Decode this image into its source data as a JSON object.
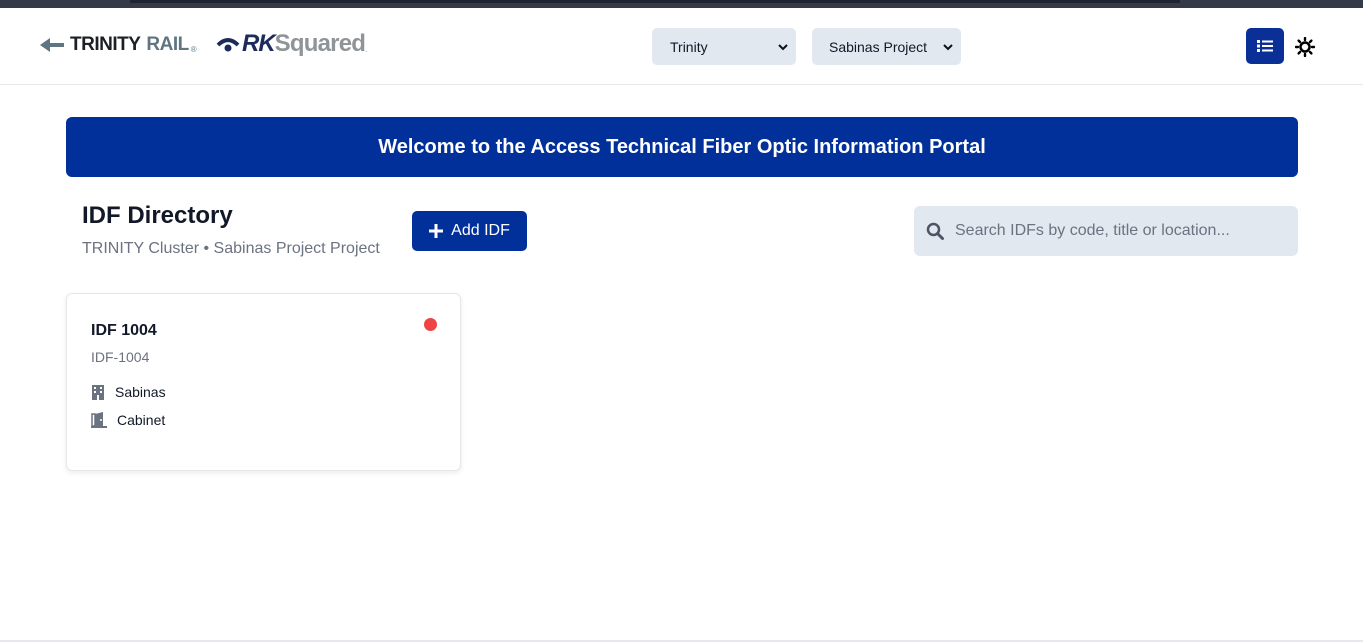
{
  "header": {
    "logo_trinity": {
      "word1": "TRINITY",
      "word2": "RAIL",
      "tm": "®"
    },
    "logo_rk": {
      "word1": "RK",
      "word2": "Squared",
      "tm": "."
    },
    "cluster_select": {
      "value": "Trinity"
    },
    "project_select": {
      "value": "Sabinas Project"
    },
    "icons": {
      "view_toggle": "list-icon",
      "theme_toggle": "sun-icon"
    }
  },
  "banner": {
    "text": "Welcome to the Access Technical Fiber Optic Information Portal"
  },
  "directory": {
    "title": "IDF Directory",
    "subtitle": "TRINITY Cluster • Sabinas Project Project",
    "add_button": "Add IDF",
    "search_placeholder": "Search IDFs by code, title or location..."
  },
  "cards": [
    {
      "title": "IDF 1004",
      "code": "IDF-1004",
      "site": "Sabinas",
      "location_type": "Cabinet",
      "status_color": "#ef4444"
    }
  ],
  "colors": {
    "primary": "#01309a",
    "input_bg": "#e2e8f0",
    "status_red": "#ef4444"
  }
}
